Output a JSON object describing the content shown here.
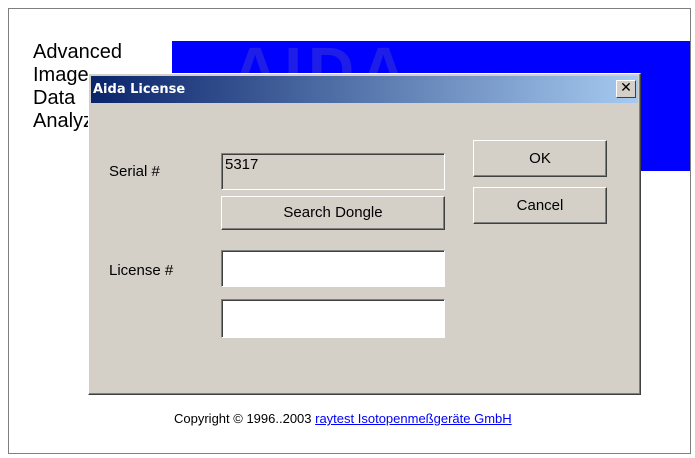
{
  "splash": {
    "title_lines": "Advanced\nImage\nData\nAnalyzer",
    "banner_text": "AIDA",
    "banner_sub": "",
    "copyright_prefix": "Copyright © 1996..2003 ",
    "copyright_link": "raytest Isotopenmeßgeräte GmbH",
    "banner_color": "#0000ff"
  },
  "dialog": {
    "title": "Aida License",
    "close_glyph": "✕",
    "serial_label": "Serial #",
    "serial_value": "5317",
    "search_button": "Search Dongle",
    "license_label": "License #",
    "license_value_1": "",
    "license_value_2": "",
    "ok_button": "OK",
    "cancel_button": "Cancel"
  }
}
